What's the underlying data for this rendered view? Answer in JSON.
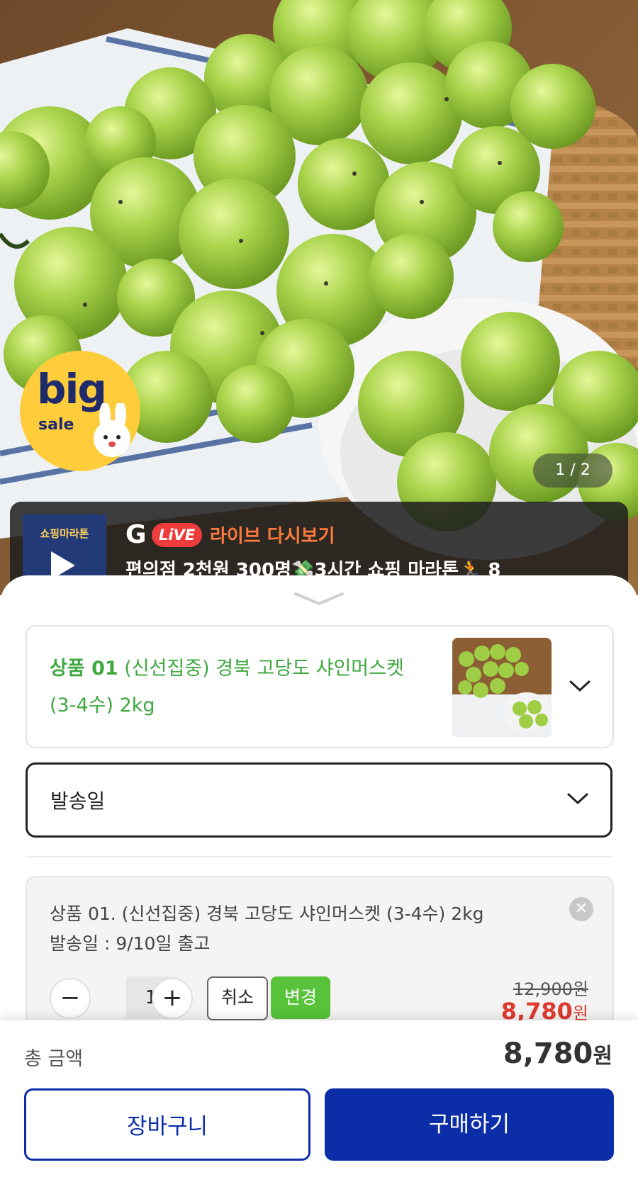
{
  "hero": {
    "badge": {
      "big": "big",
      "sale": "sale"
    },
    "counter": "1 / 2"
  },
  "live_banner": {
    "logo_g": "G",
    "logo_live": "LiVE",
    "title": "라이브 다시보기",
    "description": "편의점 2천원 300명💸3시간 쇼핑 마라톤🏃 8",
    "thumb_text": "쇼핑마라톤"
  },
  "product_select": {
    "label_prefix": "상품 01",
    "label_name": " (신선집중) 경북 고당도 샤인머스켓 (3-4수) 2kg"
  },
  "shipping_select": {
    "label": "발송일"
  },
  "selected_item": {
    "line1": "상품 01. (신선집중) 경북 고당도 샤인머스켓 (3-4수) 2kg",
    "line2": "발송일 : 9/10일 출고",
    "minus": "−",
    "quantity": "1",
    "plus": "+",
    "cancel_label": "취소",
    "change_label": "변경",
    "original_price": "12,900원",
    "sale_price_number": "8,780",
    "currency": "원",
    "close": "✕"
  },
  "footer": {
    "total_label": "총 금액",
    "total_number": "8,780",
    "currency": "원",
    "cart_label": "장바구니",
    "buy_label": "구매하기"
  },
  "colors": {
    "brand_blue": "#0b2ea8",
    "green_text": "#3fa83f",
    "change_button": "#57c23a",
    "sale_price": "#e03a2f",
    "badge_yellow": "#ffcd3c"
  }
}
